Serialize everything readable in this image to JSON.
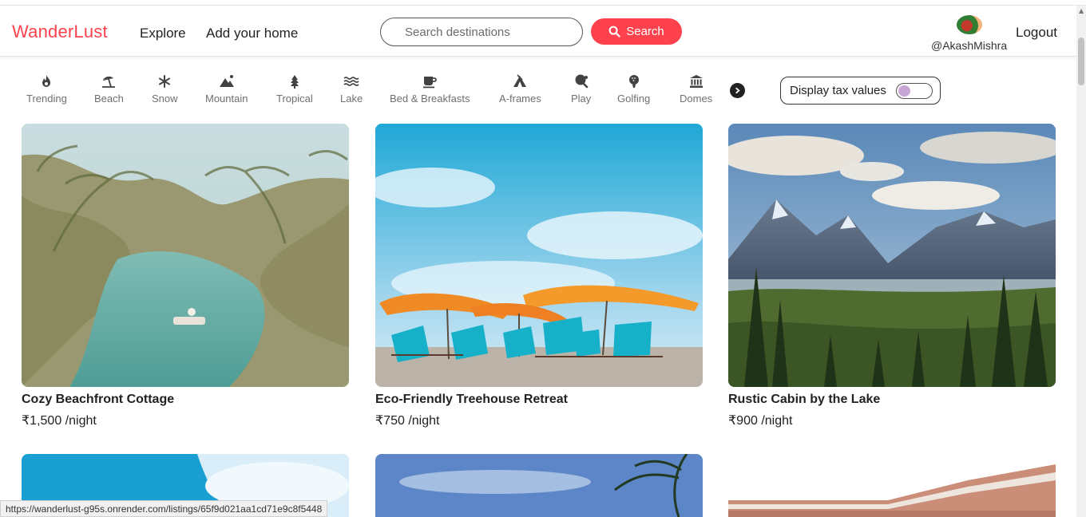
{
  "nav": {
    "brand": "WanderLust",
    "explore": "Explore",
    "add_home": "Add your home",
    "search_placeholder": "Search destinations",
    "search_button": "Search",
    "username": "@AkashMishra",
    "logout": "Logout"
  },
  "filters": [
    {
      "label": "Trending",
      "icon": "fire-icon"
    },
    {
      "label": "Beach",
      "icon": "umbrella-beach-icon"
    },
    {
      "label": "Snow",
      "icon": "snowflake-icon"
    },
    {
      "label": "Mountain",
      "icon": "mountain-icon"
    },
    {
      "label": "Tropical",
      "icon": "tree-icon"
    },
    {
      "label": "Lake",
      "icon": "water-icon"
    },
    {
      "label": "Bed & Breakfasts",
      "icon": "mug-icon"
    },
    {
      "label": "A-frames",
      "icon": "tent-icon"
    },
    {
      "label": "Play",
      "icon": "table-tennis-icon"
    },
    {
      "label": "Golfing",
      "icon": "golf-ball-icon"
    },
    {
      "label": "Domes",
      "icon": "dome-icon"
    }
  ],
  "tax_toggle": {
    "label": "Display tax values",
    "enabled": false
  },
  "listings": [
    {
      "title": "Cozy Beachfront Cottage",
      "price": "₹1,500 /night"
    },
    {
      "title": "Eco-Friendly Treehouse Retreat",
      "price": "₹750 /night"
    },
    {
      "title": "Rustic Cabin by the Lake",
      "price": "₹900 /night"
    }
  ],
  "status_url": "https://wanderlust-g95s.onrender.com/listings/65f9d021aa1cd71e9c8f5448",
  "colors": {
    "brand": "#fe424d",
    "toggle_knob": "#c7a6d6"
  }
}
